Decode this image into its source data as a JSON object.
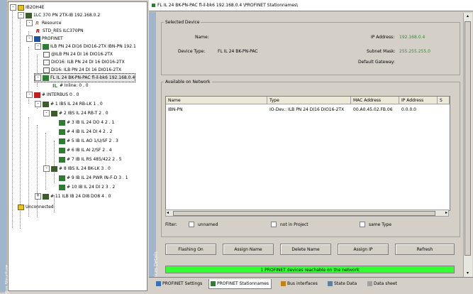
{
  "tree": {
    "panel_label": "Bus Structure",
    "nodes": [
      {
        "label": "IB2OH4E",
        "expander": "-"
      },
      {
        "label": "1LC 370 PN 2TX-IB 192.168.0.2",
        "expander": "-"
      },
      {
        "label": "Resource",
        "expander": "-"
      },
      {
        "label": "STD_RES ILC370PN",
        "expander": ""
      },
      {
        "label": "PROFINET",
        "expander": "-"
      },
      {
        "label": "ILB PN 24 DI16 DIO16-2TX IBN-PN 192.1",
        "expander": "-"
      },
      {
        "label": "@ILB PN 24 DI 16 DIO16-2TX",
        "expander": ""
      },
      {
        "label": "DIO16: ILB PN 24 DI 16 DIO16-2TX",
        "expander": ""
      },
      {
        "label": "DI16: ILB PN 24 DI 16 DIO16-2TX",
        "expander": ""
      },
      {
        "label": "FL IL 24 BK-PN-PAC fl-il-bk6 192.168.0.4",
        "expander": "-"
      },
      {
        "label": "# Inline: 0 . 0",
        "expander": ""
      },
      {
        "label": "# INTERBUS 0 . 0",
        "expander": "-"
      },
      {
        "label": "# 1 IBS IL 24 RB-LK 1 . 0",
        "expander": "-"
      },
      {
        "label": "# 2 IBS IL 24 RB-T 2 . 0",
        "expander": "-"
      },
      {
        "label": "# 3 IB IL 24 DO 4 2 . 1",
        "expander": ""
      },
      {
        "label": "# 4 IB IL 24 DI 4 2 . 2",
        "expander": ""
      },
      {
        "label": "# 5 IB IL AO 1/U/SF 2 . 3",
        "expander": ""
      },
      {
        "label": "# 6 IB IL AI 2/SF 2 . 4",
        "expander": ""
      },
      {
        "label": "# 7 IB IL RS 485/422 2 . 5",
        "expander": ""
      },
      {
        "label": "# 8 IBS IL 24 BK-LK 3 . 0",
        "expander": "-"
      },
      {
        "label": "# 9 IB IL 24 PWR IN-F-D 3 . 1",
        "expander": ""
      },
      {
        "label": "# 10 IB IL 24 DI 2 3 . 2",
        "expander": ""
      },
      {
        "label": "# 11 ILB IB 24 DI8 DO8 4 . 0",
        "expander": "+"
      },
      {
        "label": "Unconnected",
        "expander": ""
      }
    ]
  },
  "window": {
    "title": "FL IL 24 BK-PN-PAC fl-il-bk6 192.168.0.4 \\PROFINET Stationnames\\",
    "panel_label": "Devices Details"
  },
  "selected_device": {
    "legend": "Selected Device",
    "name_label": "Name:",
    "name_value": "",
    "device_type_label": "Device Type:",
    "device_type_value": "FL IL 24 BK-PN-PAC",
    "ip_label": "IP Address:",
    "ip_value": "192.168.0.4",
    "subnet_label": "Subnet Mask:",
    "subnet_value": "255.255.255.0",
    "gateway_label": "Default Gateway:",
    "gateway_value": ""
  },
  "network": {
    "legend": "Available on Network",
    "columns": [
      "Name",
      "Type",
      "MAC Address",
      "IP Address",
      "S"
    ],
    "rows": [
      [
        "IBN-PN",
        "IO-Dev.: ILB PN 24 DI16 DIO16-2TX",
        "00.A0.45.02.FB.06",
        "0.0.0.0",
        ""
      ]
    ],
    "filter_label": "Filter:",
    "filters": [
      {
        "label": "unnamed",
        "checked": false
      },
      {
        "label": "not in Project",
        "checked": false
      },
      {
        "label": "same Type",
        "checked": false
      }
    ]
  },
  "buttons": {
    "flashing": "Flashing On",
    "assign_name": "Assign Name",
    "delete_name": "Delete Name",
    "assign_ip": "Assign IP",
    "refresh": "Refresh"
  },
  "status": {
    "text": "1 PROFINET devices reachable on the network",
    "color": "#33ff33"
  },
  "tabs": [
    {
      "label": "PROFINET Settings",
      "icon": "settings-icon",
      "active": false
    },
    {
      "label": "PROFINET Stationnames",
      "icon": "stationnames-icon",
      "active": true
    },
    {
      "label": "Bus interfaces",
      "icon": "bus-icon",
      "active": false
    },
    {
      "label": "State Data",
      "icon": "state-icon",
      "active": false
    },
    {
      "label": "Data sheet",
      "icon": "datasheet-icon",
      "active": false
    }
  ]
}
